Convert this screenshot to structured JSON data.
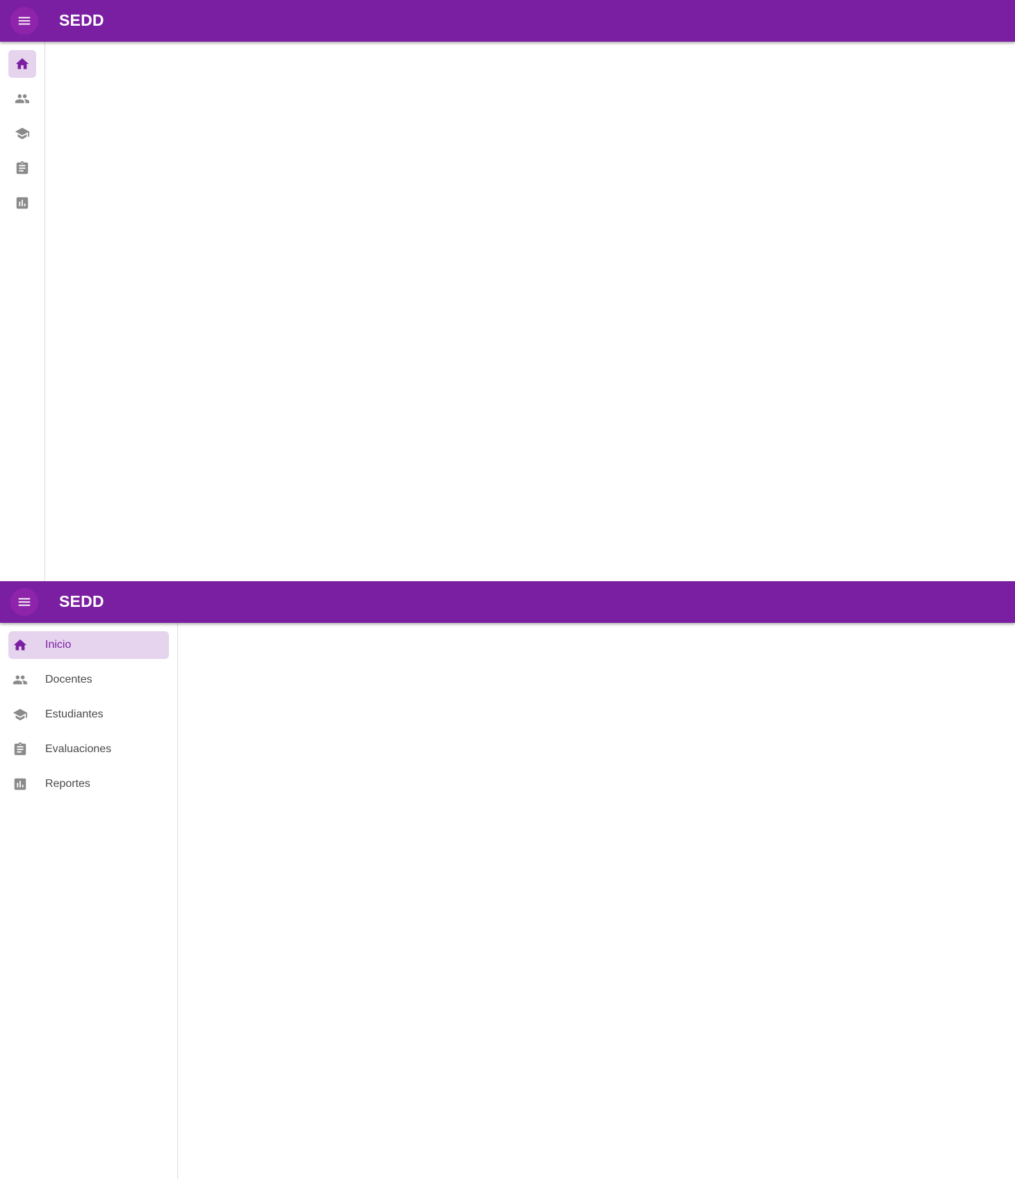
{
  "app": {
    "title": "SEDD",
    "menu_icon": "menu-icon",
    "accent_color": "#7b1fa2",
    "active_tint": "#e6d4ee"
  },
  "nav": {
    "items": [
      {
        "label": "Inicio",
        "icon": "home-icon",
        "active": true
      },
      {
        "label": "Docentes",
        "icon": "people-icon",
        "active": false
      },
      {
        "label": "Estudiantes",
        "icon": "school-icon",
        "active": false
      },
      {
        "label": "Evaluaciones",
        "icon": "assignment-icon",
        "active": false
      },
      {
        "label": "Reportes",
        "icon": "bar-chart-icon",
        "active": false
      }
    ]
  }
}
